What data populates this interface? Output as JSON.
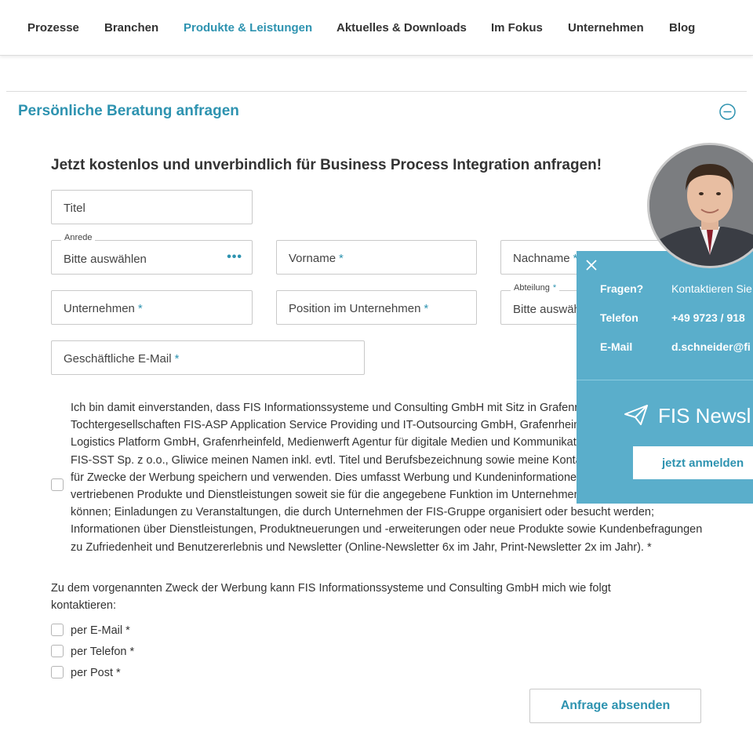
{
  "nav": {
    "items": [
      "Prozesse",
      "Branchen",
      "Produkte & Leistungen",
      "Aktuelles & Downloads",
      "Im Fokus",
      "Unternehmen",
      "Blog"
    ],
    "active": "Produkte & Leistungen"
  },
  "section": {
    "title": "Persönliche Beratung anfragen",
    "collapse_icon": "minus-circle-icon"
  },
  "form": {
    "heading": "Jetzt kostenlos und unverbindlich für Business Process Integration anfragen!",
    "fields": {
      "titel": {
        "placeholder": "Titel"
      },
      "anrede": {
        "label": "Anrede",
        "value": "Bitte auswählen"
      },
      "vorname": {
        "placeholder": "Vorname",
        "required_mark": "*"
      },
      "nachname": {
        "placeholder": "Nachname",
        "required_mark": "*"
      },
      "unternehmen": {
        "placeholder": "Unternehmen",
        "required_mark": "*"
      },
      "position": {
        "placeholder": "Position im Unternehmen",
        "required_mark": "*"
      },
      "abteilung": {
        "label": "Abteilung",
        "required_mark": "*",
        "value": "Bitte auswählen"
      },
      "email": {
        "placeholder": "Geschäftliche E-Mail",
        "required_mark": "*"
      }
    },
    "more_dots": "•••",
    "consent_text": "Ich bin damit einverstanden, dass FIS Informationssysteme und Consulting GmbH mit Sitz in Grafenrheinfeld sowie ihre Tochtergesellschaften FIS-ASP Application Service Providing und IT-Outsourcing GmbH, Grafenrheinfeld, FIS-iLog integrated Logistics Platform GmbH, Grafenrheinfeld, Medienwerft Agentur für digitale Medien und Kommunikation GmbH, Hamburg, FIS-SST Sp. z o.o., Gliwice meinen Namen inkl. evtl. Titel und Berufsbezeichnung sowie meine Kontaktdaten bis auf Widerruf für Zwecke der Werbung speichern und verwenden. Dies umfasst Werbung und Kundeninformationen bezüglich der von uns vertriebenen Produkte und Dienstleistungen soweit sie für die angegebene Funktion im Unternehmen von Interesse sein können; Einladungen zu Veranstaltungen, die durch Unternehmen der FIS-Gruppe organisiert oder besucht werden; Informationen über Dienstleistungen, Produktneuerungen und -erweiterungen oder neue Produkte sowie Kundenbefragungen zu Zufriedenheit und Benutzererlebnis und Newsletter (Online-Newsletter 6x im Jahr, Print-Newsletter 2x im Jahr). *",
    "contact_intro": "Zu dem vorgenannten Zweck der Werbung kann FIS Informationssysteme und Consulting GmbH mich wie folgt kontaktieren:",
    "contact_options": [
      "per E-Mail *",
      "per Telefon *",
      "per Post *"
    ],
    "submit_label": "Anfrage absenden"
  },
  "widget": {
    "close_icon": "close-icon",
    "rows": [
      {
        "label": "Fragen?",
        "value": "Kontaktieren Sie"
      },
      {
        "label": "Telefon",
        "value": "+49 9723 / 918"
      },
      {
        "label": "E-Mail",
        "value": "d.schneider@fi"
      }
    ],
    "newsletter_icon": "paper-plane-icon",
    "newsletter_title": "FIS Newsl",
    "newsletter_button": "jetzt anmelden"
  },
  "colors": {
    "accent": "#2e93b0",
    "widget_bg": "#5aaecb",
    "text": "#333333",
    "border": "#c9c9c9"
  }
}
